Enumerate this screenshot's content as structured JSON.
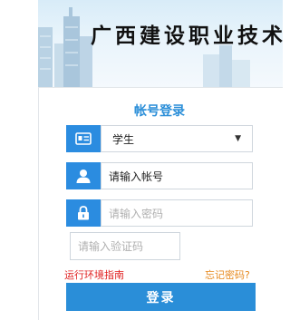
{
  "header": {
    "school_name": "广西建设职业技术"
  },
  "login": {
    "title": "帐号登录",
    "user_type": {
      "selected": "学生",
      "icon": "id-card-icon"
    },
    "account": {
      "placeholder": "请输入帐号",
      "icon": "user-icon"
    },
    "password": {
      "placeholder": "请输入密码",
      "icon": "lock-icon"
    },
    "captcha": {
      "placeholder": "请输入验证码"
    },
    "help_link": "运行环境指南",
    "forgot_link": "忘记密码?",
    "submit_label": "登录"
  },
  "colors": {
    "accent": "#2a8ed8",
    "help_link": "#e02020",
    "forgot_link": "#e78a20"
  }
}
